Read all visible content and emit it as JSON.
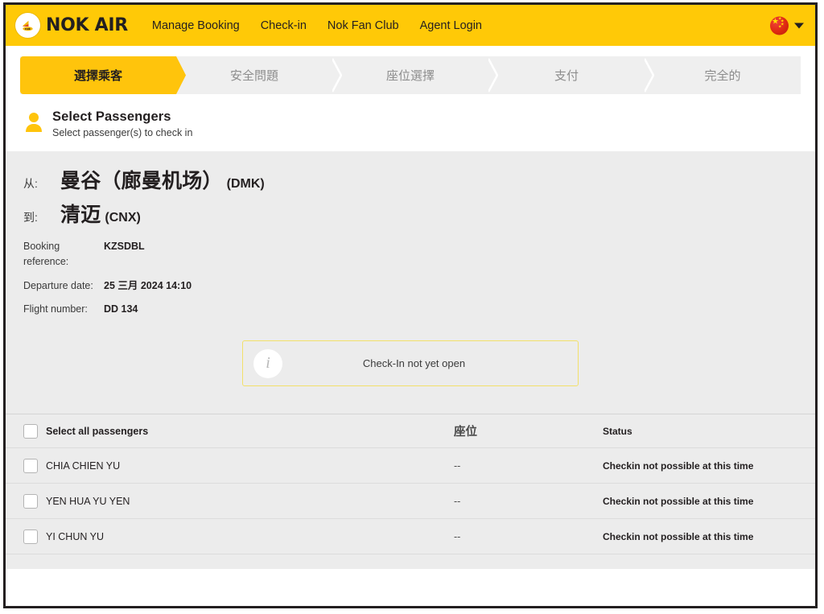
{
  "brand": {
    "name": "NOK AIR",
    "logo_icon": "nok-bird-logo-icon"
  },
  "nav": {
    "links": [
      {
        "label": "Manage Booking"
      },
      {
        "label": "Check-in"
      },
      {
        "label": "Nok Fan Club"
      },
      {
        "label": "Agent Login"
      }
    ],
    "language": {
      "flag_icon": "china-flag-icon",
      "chevron_icon": "chevron-down-icon"
    }
  },
  "stepper": {
    "steps": [
      {
        "label": "選擇乘客",
        "active": true
      },
      {
        "label": "安全問題",
        "active": false
      },
      {
        "label": "座位選擇",
        "active": false
      },
      {
        "label": "支付",
        "active": false
      },
      {
        "label": "完全的",
        "active": false
      }
    ]
  },
  "section": {
    "icon": "person-icon",
    "title": "Select Passengers",
    "subtitle": "Select passenger(s) to check in"
  },
  "flight": {
    "from_label": "从:",
    "from_city": "曼谷（廊曼机场）",
    "from_code": "(DMK)",
    "to_label": "到:",
    "to_city": "清迈",
    "to_code": "(CNX)",
    "details": [
      {
        "label": "Booking reference:",
        "value": "KZSDBL"
      },
      {
        "label": "Departure date:",
        "value": "25 三月 2024 14:10"
      },
      {
        "label": "Flight number:",
        "value": "DD 134"
      }
    ]
  },
  "notice": {
    "icon": "info-icon",
    "glyph": "i",
    "text": "Check-In not yet open"
  },
  "passenger_table": {
    "headers": {
      "select_all": "Select all passengers",
      "seat": "座位",
      "status": "Status"
    },
    "rows": [
      {
        "name": "CHIA CHIEN YU",
        "seat": "--",
        "status": "Checkin not possible at this time"
      },
      {
        "name": "YEN HUA YU YEN",
        "seat": "--",
        "status": "Checkin not possible at this time"
      },
      {
        "name": "YI CHUN YU",
        "seat": "--",
        "status": "Checkin not possible at this time"
      }
    ]
  },
  "colors": {
    "brand_yellow": "#ffc907",
    "step_active": "#ffc40c",
    "panel_grey": "#ececec",
    "notice_border": "#f2e06a",
    "text_dark": "#231f20"
  }
}
